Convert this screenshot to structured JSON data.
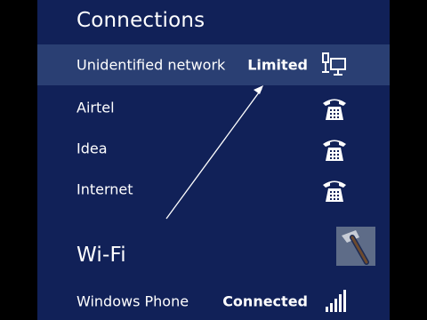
{
  "connections": {
    "title": "Connections",
    "items": [
      {
        "name": "Unidentified network",
        "status": "Limited",
        "icon": "network-monitor-icon",
        "selected": true
      },
      {
        "name": "Airtel",
        "status": "",
        "icon": "phone-icon"
      },
      {
        "name": "Idea",
        "status": "",
        "icon": "phone-icon"
      },
      {
        "name": "Internet",
        "status": "",
        "icon": "phone-icon"
      }
    ]
  },
  "wifi": {
    "title": "Wi-Fi",
    "items": [
      {
        "name": "Windows Phone",
        "status": "Connected",
        "icon": "wifi-signal-icon"
      }
    ]
  },
  "colors": {
    "panel_background": "#112158",
    "selected_row": "#2a3f73",
    "text": "#ffffff"
  }
}
